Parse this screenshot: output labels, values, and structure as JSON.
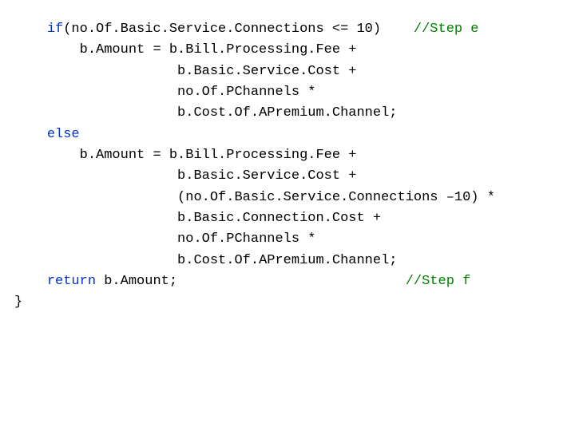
{
  "code": {
    "lines": [
      {
        "indent": 4,
        "segments": [
          {
            "text": "if",
            "style": "kw"
          },
          {
            "text": "(no.Of.Basic.Service.Connections <= 10)    ",
            "style": "plain"
          },
          {
            "text": "//Step e",
            "style": "comment"
          }
        ]
      },
      {
        "indent": 8,
        "segments": [
          {
            "text": "b.Amount = b.Bill.Processing.Fee +",
            "style": "plain"
          }
        ]
      },
      {
        "indent": 20,
        "segments": [
          {
            "text": "b.Basic.Service.Cost +",
            "style": "plain"
          }
        ]
      },
      {
        "indent": 20,
        "segments": [
          {
            "text": "no.Of.PChannels *",
            "style": "plain"
          }
        ]
      },
      {
        "indent": 20,
        "segments": [
          {
            "text": "b.Cost.Of.APremium.Channel;",
            "style": "plain"
          }
        ]
      },
      {
        "indent": 4,
        "segments": [
          {
            "text": "else",
            "style": "kw"
          }
        ]
      },
      {
        "indent": 8,
        "segments": [
          {
            "text": "b.Amount = b.Bill.Processing.Fee +",
            "style": "plain"
          }
        ]
      },
      {
        "indent": 20,
        "segments": [
          {
            "text": "b.Basic.Service.Cost +",
            "style": "plain"
          }
        ]
      },
      {
        "indent": 20,
        "segments": [
          {
            "text": "(no.Of.Basic.Service.Connections –10) *",
            "style": "plain"
          }
        ]
      },
      {
        "indent": 20,
        "segments": [
          {
            "text": "b.Basic.Connection.Cost +",
            "style": "plain"
          }
        ]
      },
      {
        "indent": 20,
        "segments": [
          {
            "text": "no.Of.PChannels *",
            "style": "plain"
          }
        ]
      },
      {
        "indent": 20,
        "segments": [
          {
            "text": "b.Cost.Of.APremium.Channel;",
            "style": "plain"
          }
        ]
      },
      {
        "indent": 0,
        "segments": [
          {
            "text": "",
            "style": "plain"
          }
        ]
      },
      {
        "indent": 4,
        "segments": [
          {
            "text": "return",
            "style": "kw"
          },
          {
            "text": " b.Amount;                            ",
            "style": "plain"
          },
          {
            "text": "//Step f",
            "style": "comment"
          }
        ]
      },
      {
        "indent": 0,
        "segments": [
          {
            "text": "}",
            "style": "plain"
          }
        ]
      }
    ]
  }
}
